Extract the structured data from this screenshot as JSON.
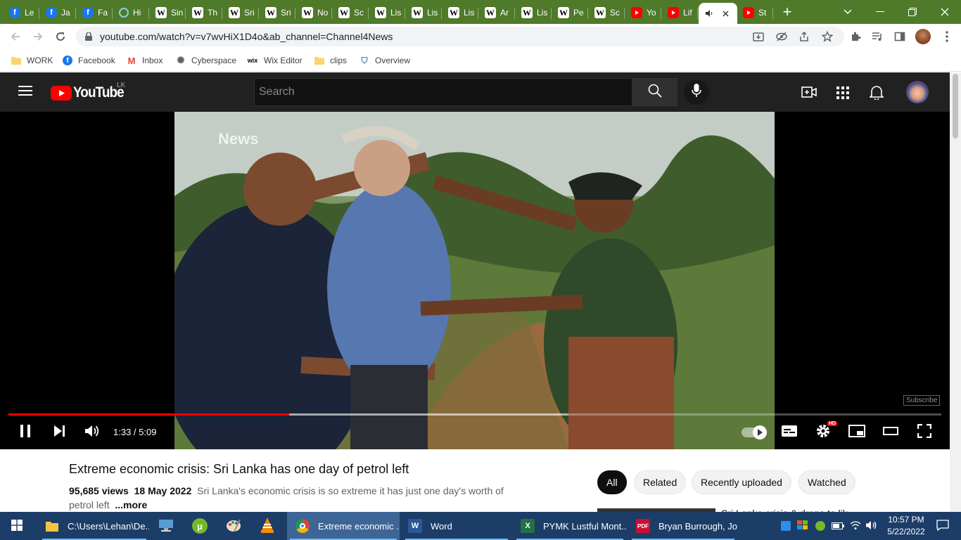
{
  "browser": {
    "tabs": [
      {
        "label": "Le",
        "icon": "facebook-icon",
        "kind": "fb"
      },
      {
        "label": "Ja",
        "icon": "facebook-icon",
        "kind": "fb"
      },
      {
        "label": "Fa",
        "icon": "facebook-icon",
        "kind": "fb"
      },
      {
        "label": "Hi",
        "icon": "history-icon",
        "kind": "hi"
      },
      {
        "label": "Sin",
        "icon": "wikipedia-icon",
        "kind": "wk"
      },
      {
        "label": "Th",
        "icon": "wikipedia-icon",
        "kind": "wk"
      },
      {
        "label": "Sri",
        "icon": "wikipedia-icon",
        "kind": "wk"
      },
      {
        "label": "Sri",
        "icon": "wikipedia-icon",
        "kind": "wk"
      },
      {
        "label": "No",
        "icon": "wikipedia-icon",
        "kind": "wk"
      },
      {
        "label": "Sc",
        "icon": "wikipedia-icon",
        "kind": "wk"
      },
      {
        "label": "Lis",
        "icon": "wikipedia-icon",
        "kind": "wk"
      },
      {
        "label": "Lis",
        "icon": "wikipedia-icon",
        "kind": "wk"
      },
      {
        "label": "Lis",
        "icon": "wikipedia-icon",
        "kind": "wk"
      },
      {
        "label": "Ar",
        "icon": "wikipedia-icon",
        "kind": "wk"
      },
      {
        "label": "Lis",
        "icon": "wikipedia-icon",
        "kind": "wk"
      },
      {
        "label": "Pe",
        "icon": "wikipedia-icon",
        "kind": "wk"
      },
      {
        "label": "Sc",
        "icon": "wikipedia-icon",
        "kind": "wk"
      },
      {
        "label": "Yo",
        "icon": "youtube-icon",
        "kind": "yt"
      },
      {
        "label": "Lif",
        "icon": "youtube-icon",
        "kind": "yt"
      },
      {
        "label": "",
        "icon": "speaker-icon",
        "kind": "active"
      },
      {
        "label": "St",
        "icon": "youtube-icon",
        "kind": "yt"
      }
    ],
    "new_tab_symbol": "+",
    "url": "youtube.com/watch?v=v7wvHiX1D4o&ab_channel=Channel4News",
    "bookmarks": [
      {
        "label": "WORK",
        "icon": "folder-icon"
      },
      {
        "label": "Facebook",
        "icon": "facebook-icon"
      },
      {
        "label": "Inbox",
        "icon": "gmail-icon"
      },
      {
        "label": "Cyberspace",
        "icon": "cyberspace-icon"
      },
      {
        "label": "Wix Editor",
        "icon": "wix-icon"
      },
      {
        "label": "clips",
        "icon": "folder-icon"
      },
      {
        "label": "Overview",
        "icon": "overview-icon"
      }
    ]
  },
  "youtube": {
    "logo_text": "YouTube",
    "country_code": "LK",
    "search_placeholder": "Search",
    "player": {
      "watermark": "News",
      "subscribe_watermark": "Subscribe",
      "time_display": "1:33 / 5:09",
      "progress_fraction": 0.301,
      "buffered_fraction": 0.6,
      "hd_badge": "HD"
    },
    "video": {
      "title": "Extreme economic crisis: Sri Lanka has one day of petrol left",
      "views": "95,685 views",
      "date": "18 May 2022",
      "description": "Sri Lanka's economic crisis is so extreme it has just one day's worth of petrol left",
      "more_label": "...more"
    },
    "chips": [
      "All",
      "Related",
      "Recently uploaded",
      "Watched"
    ],
    "next_video_snippet": "Sri Lanka crisis & drops to lik"
  },
  "taskbar": {
    "items": [
      {
        "label": "C:\\Users\\Lehan\\De...",
        "icon": "file-explorer-icon"
      },
      {
        "label": "",
        "icon": "network-drive-icon"
      },
      {
        "label": "",
        "icon": "utorrent-icon"
      },
      {
        "label": "",
        "icon": "paint-icon"
      },
      {
        "label": "",
        "icon": "vlc-icon"
      },
      {
        "label": "Extreme economic ...",
        "icon": "chrome-icon"
      },
      {
        "label": "Word",
        "icon": "word-icon"
      },
      {
        "label": "PYMK Lustful Mont...",
        "icon": "excel-icon"
      },
      {
        "label": "Bryan Burrough, Jo...",
        "icon": "pdf-icon"
      }
    ],
    "time": "10:57 PM",
    "date": "5/22/2022"
  },
  "colors": {
    "tabstrip": "#4e7a2a",
    "yt_red": "#ff0000",
    "taskbar": "#1c3d67"
  }
}
